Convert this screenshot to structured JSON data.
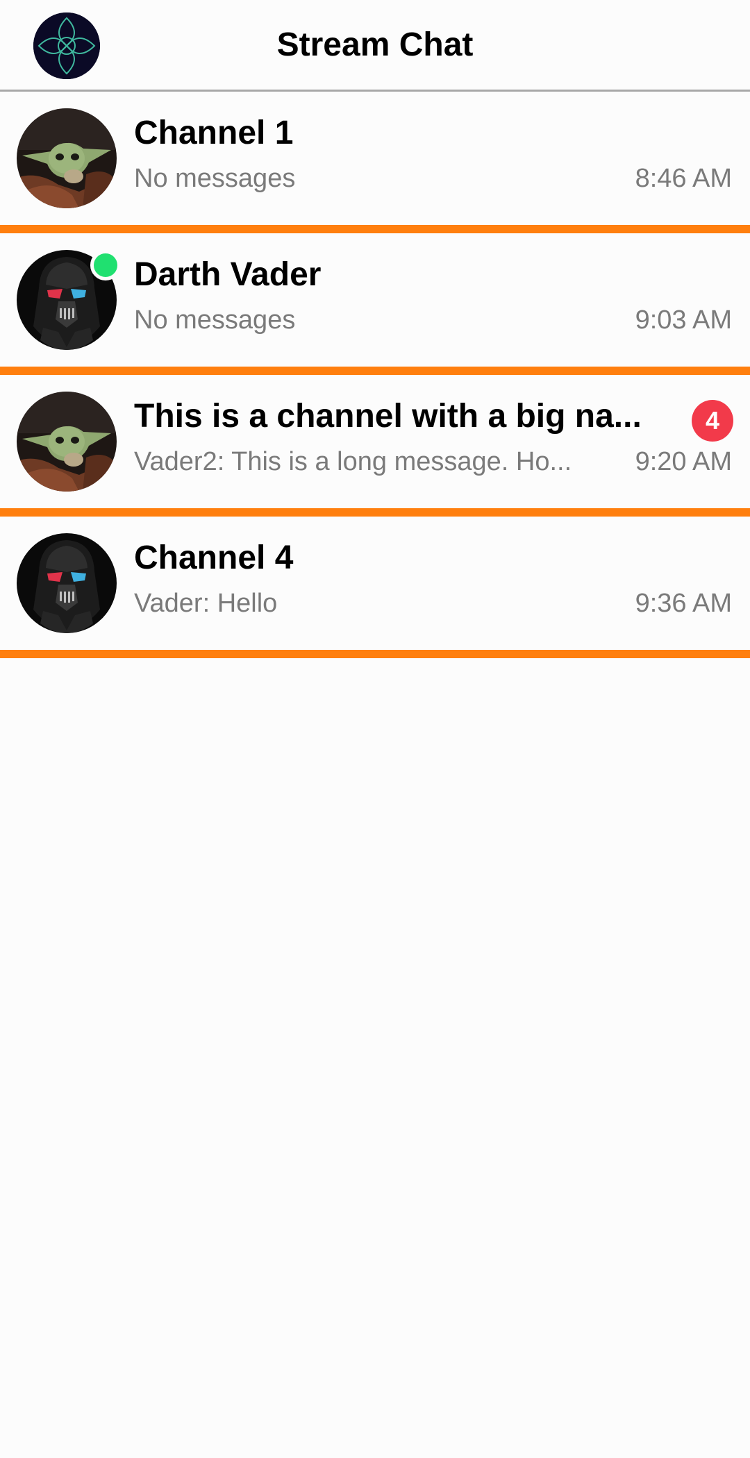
{
  "header": {
    "title": "Stream Chat",
    "avatar_icon": "stream-logo-icon"
  },
  "channels": [
    {
      "name": "Channel 1",
      "preview": "No messages",
      "time": "8:46 AM",
      "avatar": "baby-yoda-avatar",
      "online": false,
      "unread": null
    },
    {
      "name": "Darth Vader",
      "preview": "No messages",
      "time": "9:03 AM",
      "avatar": "darth-vader-avatar",
      "online": true,
      "unread": null
    },
    {
      "name": "This is a channel with a big na...",
      "preview": "Vader2: This is a long message. Ho...",
      "time": "9:20 AM",
      "avatar": "baby-yoda-avatar",
      "online": false,
      "unread": "4"
    },
    {
      "name": "Channel 4",
      "preview": "Vader: Hello",
      "time": "9:36 AM",
      "avatar": "darth-vader-avatar",
      "online": false,
      "unread": null
    }
  ],
  "colors": {
    "separator": "#ff7f0e",
    "unread_badge": "#f23a4a",
    "online": "#20e070",
    "secondary_text": "#7a7a7a"
  }
}
